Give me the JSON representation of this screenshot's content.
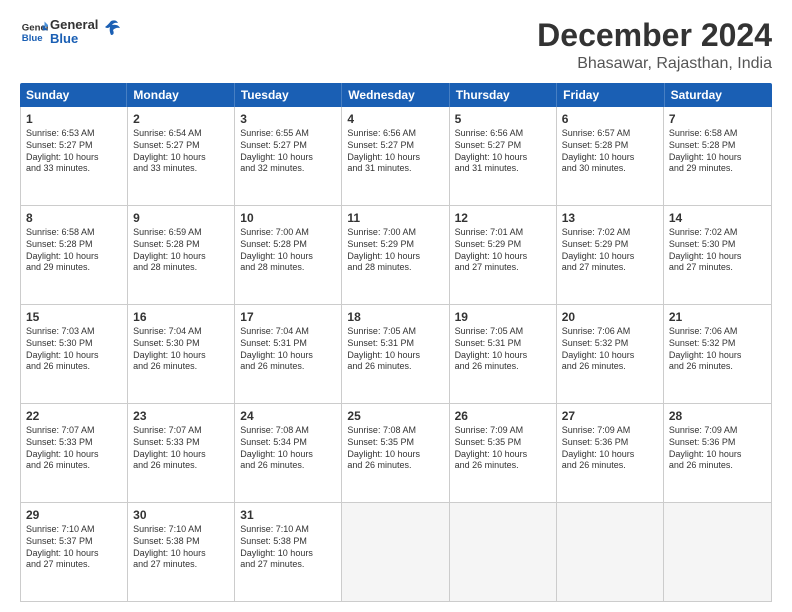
{
  "logo": {
    "text_general": "General",
    "text_blue": "Blue"
  },
  "header": {
    "title": "December 2024",
    "subtitle": "Bhasawar, Rajasthan, India"
  },
  "calendar": {
    "days_of_week": [
      "Sunday",
      "Monday",
      "Tuesday",
      "Wednesday",
      "Thursday",
      "Friday",
      "Saturday"
    ],
    "weeks": [
      [
        {
          "day": "",
          "info": "",
          "empty": true
        },
        {
          "day": "",
          "info": "",
          "empty": true
        },
        {
          "day": "",
          "info": "",
          "empty": true
        },
        {
          "day": "",
          "info": "",
          "empty": true
        },
        {
          "day": "",
          "info": "",
          "empty": true
        },
        {
          "day": "",
          "info": "",
          "empty": true
        },
        {
          "day": "",
          "info": "",
          "empty": true
        }
      ],
      [
        {
          "day": "1",
          "info": "Sunrise: 6:53 AM\nSunset: 5:27 PM\nDaylight: 10 hours\nand 33 minutes."
        },
        {
          "day": "2",
          "info": "Sunrise: 6:54 AM\nSunset: 5:27 PM\nDaylight: 10 hours\nand 33 minutes."
        },
        {
          "day": "3",
          "info": "Sunrise: 6:55 AM\nSunset: 5:27 PM\nDaylight: 10 hours\nand 32 minutes."
        },
        {
          "day": "4",
          "info": "Sunrise: 6:56 AM\nSunset: 5:27 PM\nDaylight: 10 hours\nand 31 minutes."
        },
        {
          "day": "5",
          "info": "Sunrise: 6:56 AM\nSunset: 5:27 PM\nDaylight: 10 hours\nand 31 minutes."
        },
        {
          "day": "6",
          "info": "Sunrise: 6:57 AM\nSunset: 5:28 PM\nDaylight: 10 hours\nand 30 minutes."
        },
        {
          "day": "7",
          "info": "Sunrise: 6:58 AM\nSunset: 5:28 PM\nDaylight: 10 hours\nand 29 minutes."
        }
      ],
      [
        {
          "day": "8",
          "info": "Sunrise: 6:58 AM\nSunset: 5:28 PM\nDaylight: 10 hours\nand 29 minutes."
        },
        {
          "day": "9",
          "info": "Sunrise: 6:59 AM\nSunset: 5:28 PM\nDaylight: 10 hours\nand 28 minutes."
        },
        {
          "day": "10",
          "info": "Sunrise: 7:00 AM\nSunset: 5:28 PM\nDaylight: 10 hours\nand 28 minutes."
        },
        {
          "day": "11",
          "info": "Sunrise: 7:00 AM\nSunset: 5:29 PM\nDaylight: 10 hours\nand 28 minutes."
        },
        {
          "day": "12",
          "info": "Sunrise: 7:01 AM\nSunset: 5:29 PM\nDaylight: 10 hours\nand 27 minutes."
        },
        {
          "day": "13",
          "info": "Sunrise: 7:02 AM\nSunset: 5:29 PM\nDaylight: 10 hours\nand 27 minutes."
        },
        {
          "day": "14",
          "info": "Sunrise: 7:02 AM\nSunset: 5:30 PM\nDaylight: 10 hours\nand 27 minutes."
        }
      ],
      [
        {
          "day": "15",
          "info": "Sunrise: 7:03 AM\nSunset: 5:30 PM\nDaylight: 10 hours\nand 26 minutes."
        },
        {
          "day": "16",
          "info": "Sunrise: 7:04 AM\nSunset: 5:30 PM\nDaylight: 10 hours\nand 26 minutes."
        },
        {
          "day": "17",
          "info": "Sunrise: 7:04 AM\nSunset: 5:31 PM\nDaylight: 10 hours\nand 26 minutes."
        },
        {
          "day": "18",
          "info": "Sunrise: 7:05 AM\nSunset: 5:31 PM\nDaylight: 10 hours\nand 26 minutes."
        },
        {
          "day": "19",
          "info": "Sunrise: 7:05 AM\nSunset: 5:31 PM\nDaylight: 10 hours\nand 26 minutes."
        },
        {
          "day": "20",
          "info": "Sunrise: 7:06 AM\nSunset: 5:32 PM\nDaylight: 10 hours\nand 26 minutes."
        },
        {
          "day": "21",
          "info": "Sunrise: 7:06 AM\nSunset: 5:32 PM\nDaylight: 10 hours\nand 26 minutes."
        }
      ],
      [
        {
          "day": "22",
          "info": "Sunrise: 7:07 AM\nSunset: 5:33 PM\nDaylight: 10 hours\nand 26 minutes."
        },
        {
          "day": "23",
          "info": "Sunrise: 7:07 AM\nSunset: 5:33 PM\nDaylight: 10 hours\nand 26 minutes."
        },
        {
          "day": "24",
          "info": "Sunrise: 7:08 AM\nSunset: 5:34 PM\nDaylight: 10 hours\nand 26 minutes."
        },
        {
          "day": "25",
          "info": "Sunrise: 7:08 AM\nSunset: 5:35 PM\nDaylight: 10 hours\nand 26 minutes."
        },
        {
          "day": "26",
          "info": "Sunrise: 7:09 AM\nSunset: 5:35 PM\nDaylight: 10 hours\nand 26 minutes."
        },
        {
          "day": "27",
          "info": "Sunrise: 7:09 AM\nSunset: 5:36 PM\nDaylight: 10 hours\nand 26 minutes."
        },
        {
          "day": "28",
          "info": "Sunrise: 7:09 AM\nSunset: 5:36 PM\nDaylight: 10 hours\nand 26 minutes."
        }
      ],
      [
        {
          "day": "29",
          "info": "Sunrise: 7:10 AM\nSunset: 5:37 PM\nDaylight: 10 hours\nand 27 minutes."
        },
        {
          "day": "30",
          "info": "Sunrise: 7:10 AM\nSunset: 5:38 PM\nDaylight: 10 hours\nand 27 minutes."
        },
        {
          "day": "31",
          "info": "Sunrise: 7:10 AM\nSunset: 5:38 PM\nDaylight: 10 hours\nand 27 minutes."
        },
        {
          "day": "",
          "info": "",
          "empty": true
        },
        {
          "day": "",
          "info": "",
          "empty": true
        },
        {
          "day": "",
          "info": "",
          "empty": true
        },
        {
          "day": "",
          "info": "",
          "empty": true
        }
      ]
    ]
  }
}
